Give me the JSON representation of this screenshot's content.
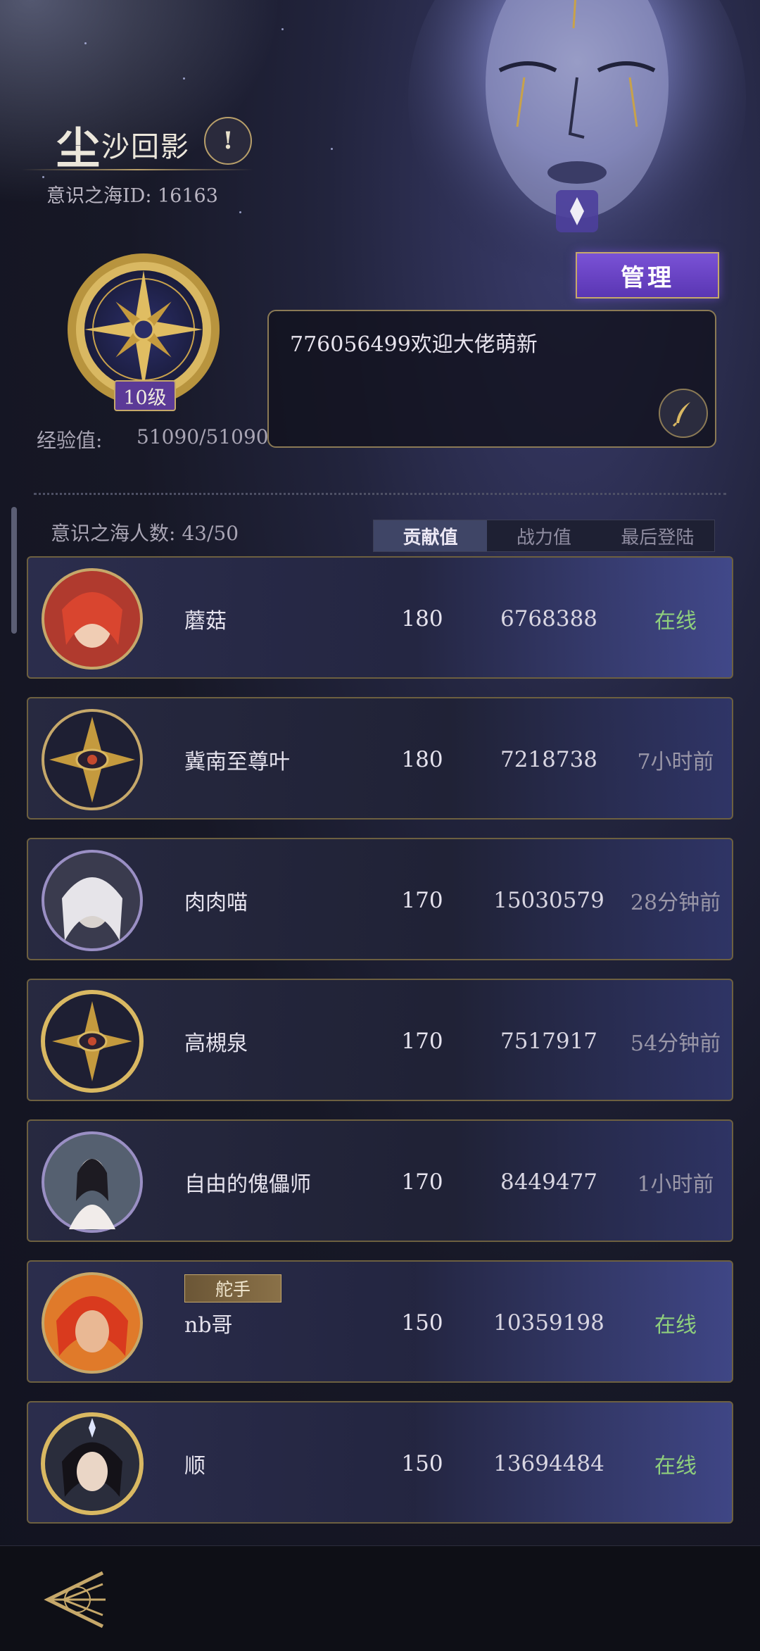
{
  "guild": {
    "name_first": "尘",
    "name_rest": "沙回影",
    "id_text": "意识之海ID: 16163",
    "level_badge": "10级",
    "exp_label": "经验值:",
    "exp_value": "51090/51090"
  },
  "actions": {
    "manage_label": "管理"
  },
  "notice": {
    "text": "776056499欢迎大佬萌新"
  },
  "members_header": {
    "count_text": "意识之海人数: 43/50",
    "tabs": [
      "贡献值",
      "战力值",
      "最后登陆"
    ],
    "active_tab": "贡献值"
  },
  "members": [
    {
      "name": "蘑菇",
      "contribution": "180",
      "power": "6768388",
      "status": "在线",
      "role": ""
    },
    {
      "name": "冀南至尊叶",
      "contribution": "180",
      "power": "7218738",
      "status": "7小时前",
      "role": ""
    },
    {
      "name": "肉肉喵",
      "contribution": "170",
      "power": "15030579",
      "status": "28分钟前",
      "role": ""
    },
    {
      "name": "高槻泉",
      "contribution": "170",
      "power": "7517917",
      "status": "54分钟前",
      "role": ""
    },
    {
      "name": "自由的傀儡师",
      "contribution": "170",
      "power": "8449477",
      "status": "1小时前",
      "role": ""
    },
    {
      "name": "nb哥",
      "contribution": "150",
      "power": "10359198",
      "status": "在线",
      "role": "舵手"
    },
    {
      "name": "顺",
      "contribution": "150",
      "power": "13694484",
      "status": "在线",
      "role": ""
    }
  ],
  "colors": {
    "online": "#8fcf7c",
    "gold_border": "#c6a86a",
    "accent_purple": "#6a44c6"
  },
  "icons": {
    "warning": "exclamation-icon",
    "edit": "quill-icon",
    "back": "back-arrow-icon"
  }
}
